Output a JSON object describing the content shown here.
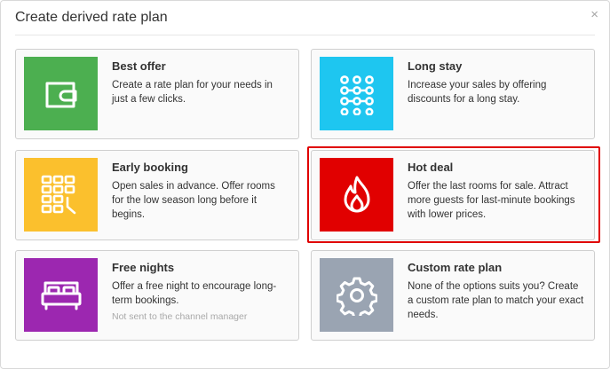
{
  "dialog": {
    "title": "Create derived rate plan",
    "close_glyph": "×"
  },
  "cards": [
    {
      "id": "best-offer",
      "title": "Best offer",
      "description": "Create a rate plan for your needs in just a few clicks.",
      "icon": "wallet-icon",
      "color": "#4caf50"
    },
    {
      "id": "long-stay",
      "title": "Long stay",
      "description": "Increase your sales by offering discounts for a long stay.",
      "icon": "dots-grid-icon",
      "color": "#1ec6f0"
    },
    {
      "id": "early-booking",
      "title": "Early booking",
      "description": "Open sales in advance. Offer rooms for the low season long before it begins.",
      "icon": "calendar-clock-icon",
      "color": "#fbc02d"
    },
    {
      "id": "hot-deal",
      "title": "Hot deal",
      "description": "Offer the last rooms for sale. Attract more guests for last-minute bookings with lower prices.",
      "icon": "flame-icon",
      "color": "#e10000",
      "highlighted": true
    },
    {
      "id": "free-nights",
      "title": "Free nights",
      "description": "Offer a free night to encourage long-term bookings.",
      "note": "Not sent to the channel manager",
      "icon": "bed-icon",
      "color": "#9c27b0"
    },
    {
      "id": "custom-rate-plan",
      "title": "Custom rate plan",
      "description": "None of the options suits you? Create a custom rate plan to match your exact needs.",
      "icon": "gear-icon",
      "color": "#9aa4b2"
    }
  ],
  "highlight_color": "#e00000"
}
